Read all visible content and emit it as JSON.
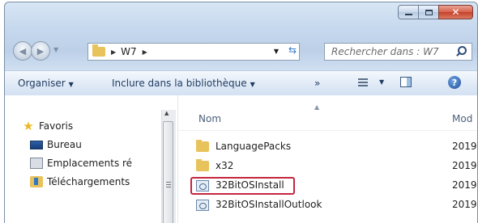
{
  "address_bar": {
    "path": [
      "W7"
    ]
  },
  "search": {
    "placeholder": "Rechercher dans : W7"
  },
  "command_bar": {
    "organize": "Organiser",
    "include_library": "Inclure dans la bibliothèque",
    "more": "»"
  },
  "navigation_pane": {
    "items": [
      {
        "label": "Favoris",
        "icon": "star-icon"
      },
      {
        "label": "Bureau",
        "icon": "desktop-icon"
      },
      {
        "label": "Emplacements ré",
        "icon": "places-icon"
      },
      {
        "label": "Téléchargements",
        "icon": "downloads-icon"
      }
    ]
  },
  "file_list": {
    "columns": {
      "name": "Nom",
      "modified": "Mod"
    },
    "rows": [
      {
        "name": "LanguagePacks",
        "date": "2019",
        "icon": "folder-icon"
      },
      {
        "name": "x32",
        "date": "2019",
        "icon": "folder-icon"
      },
      {
        "name": "32BitOSInstall",
        "date": "2019",
        "icon": "setup-file-icon",
        "highlighted": true
      },
      {
        "name": "32BitOSInstallOutlook",
        "date": "2019",
        "icon": "setup-file-icon"
      }
    ]
  },
  "colors": {
    "highlight_border": "#c4263f",
    "close_button": "#c4412b"
  }
}
